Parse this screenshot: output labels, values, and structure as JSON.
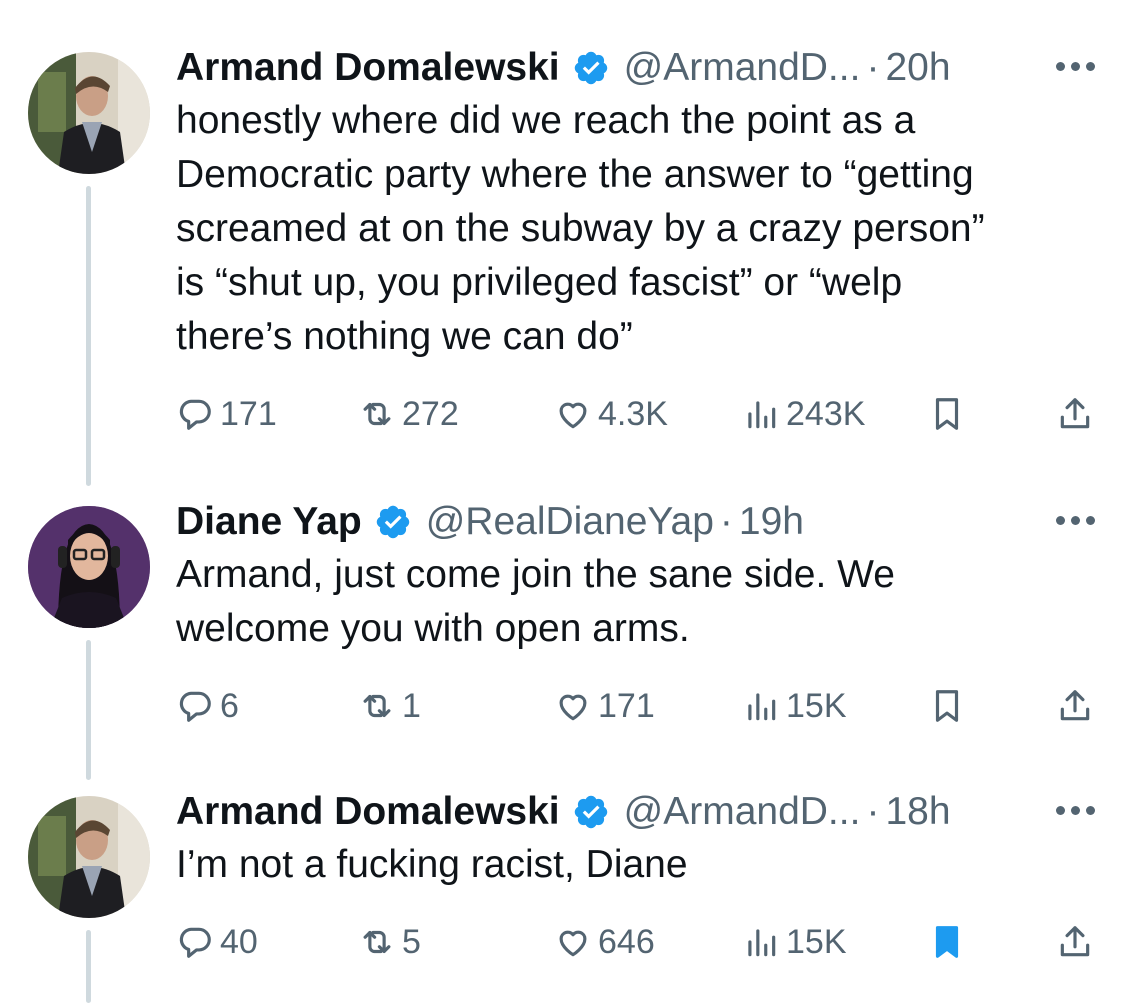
{
  "tweets": [
    {
      "author": "Armand Domalewski",
      "handle": "@ArmandD...",
      "time": "20h",
      "text": "honestly where did we reach the point as a\nDemocratic party where the answer to “getting\nscreamed at on the subway by a crazy person”\nis “shut up, you privileged fascist” or “welp\nthere’s nothing we can do”",
      "replies": "171",
      "reposts": "272",
      "likes": "4.3K",
      "views": "243K",
      "bookmarked": false
    },
    {
      "author": "Diane Yap",
      "handle": "@RealDianeYap",
      "time": "19h",
      "text": "Armand, just come join the sane side. We\nwelcome you with open arms.",
      "replies": "6",
      "reposts": "1",
      "likes": "171",
      "views": "15K",
      "bookmarked": false
    },
    {
      "author": "Armand Domalewski",
      "handle": "@ArmandD...",
      "time": "18h",
      "text": "I’m not a fucking racist, Diane",
      "replies": "40",
      "reposts": "5",
      "likes": "646",
      "views": "15K",
      "bookmarked": true
    }
  ],
  "dot_separator": "·",
  "icons": {
    "verified": "verified-badge-icon",
    "more": "more-options-icon",
    "reply": "reply-icon",
    "repost": "repost-icon",
    "like": "like-icon",
    "views": "views-icon",
    "bookmark": "bookmark-icon",
    "share": "share-icon"
  },
  "colors": {
    "text": "#0f1419",
    "secondary": "#536471",
    "verified": "#1d9bf0",
    "thread_line": "#cfd9de",
    "bookmark_active": "#1d9bf0"
  }
}
